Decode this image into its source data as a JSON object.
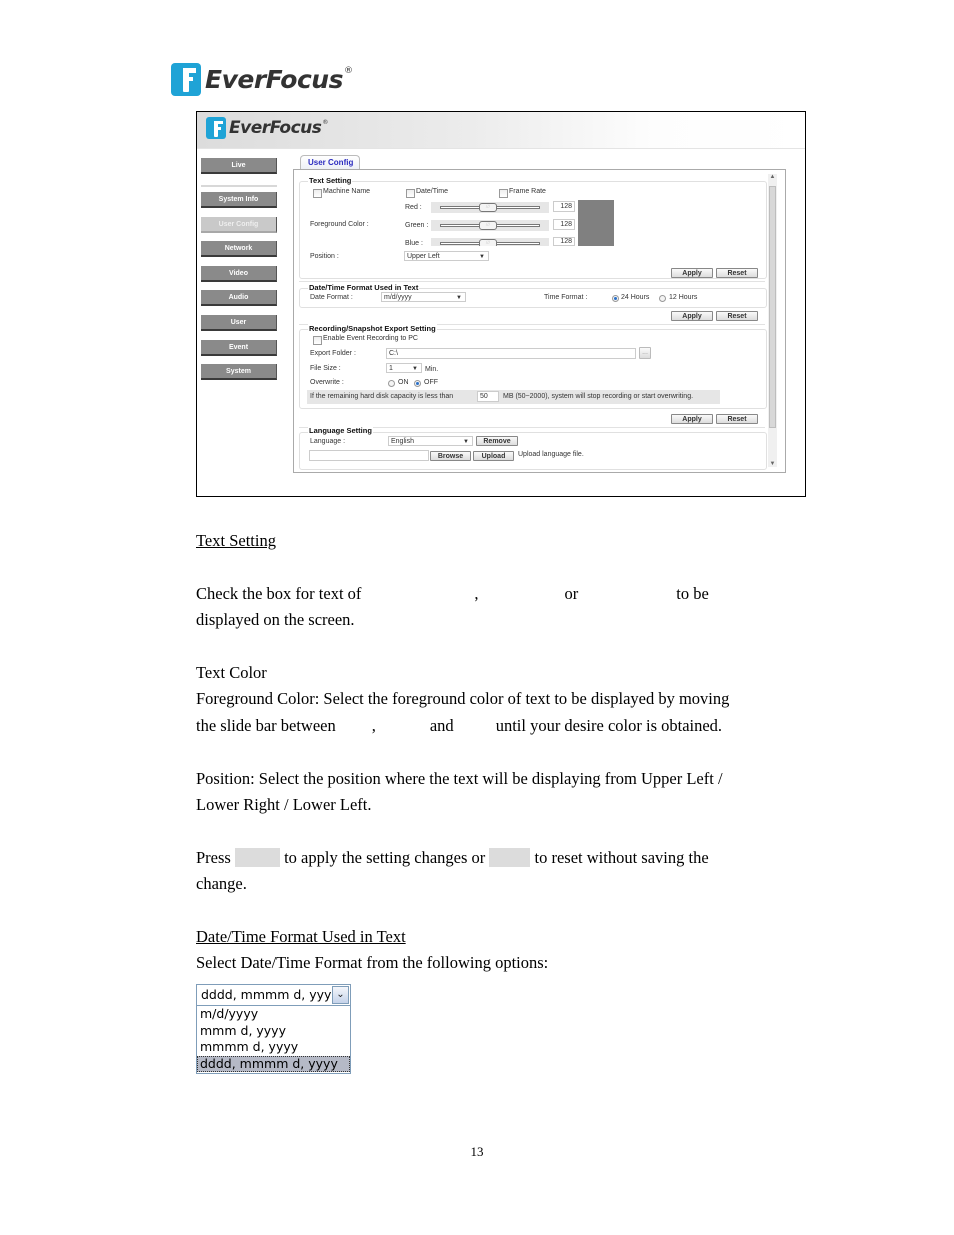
{
  "brand": {
    "name": "EverFocus",
    "reg": "®"
  },
  "screenshot": {
    "nav": [
      "Live",
      "System Info",
      "User Config",
      "Network",
      "Video",
      "Audio",
      "User",
      "Event",
      "System"
    ],
    "active_nav": "User Config",
    "tab": "User Config",
    "text_setting": {
      "title": "Text Setting",
      "checkboxes": [
        "Machine Name",
        "Date/Time",
        "Frame Rate"
      ],
      "foreground_label": "Foreground Color :",
      "red_label": "Red :",
      "green_label": "Green :",
      "blue_label": "Blue :",
      "red": "128",
      "green": "128",
      "blue": "128",
      "preview_color": "#808080",
      "position_label": "Position :",
      "position_value": "Upper Left"
    },
    "datetime": {
      "title": "Date/Time Format Used in Text",
      "date_label": "Date Format :",
      "date_value": "m/d/yyyy",
      "time_label": "Time Format :",
      "time_24": "24 Hours",
      "time_12": "12 Hours",
      "selected_time": "24 Hours"
    },
    "recording": {
      "title": "Recording/Snapshot Export Setting",
      "enable_label": "Enable Event Recording to PC",
      "export_label": "Export Folder :",
      "export_value": "C:\\",
      "browse_dots": "...",
      "filesize_label": "File Size :",
      "filesize_value": "1",
      "filesize_unit": "Min.",
      "overwrite_label": "Overwrite :",
      "on": "ON",
      "off": "OFF",
      "selected_overwrite": "OFF",
      "capacity_pre": "If the remaining hard disk capacity is less than",
      "capacity_value": "50",
      "capacity_post": "MB (50~2000), system will stop recording or start overwriting."
    },
    "language": {
      "title": "Language Setting",
      "label": "Language :",
      "value": "English",
      "remove": "Remove",
      "browse": "Browse",
      "upload": "Upload",
      "upload_hint": "Upload language file."
    },
    "apply": "Apply",
    "reset": "Reset"
  },
  "doc": {
    "h_text_setting": "Text Setting",
    "p1_a": "Check the box for text of",
    "p1_b": ",",
    "p1_c": "or",
    "p1_d": "to be",
    "p1_line2": "displayed on the screen.",
    "text_color": "Text Color",
    "fg_line1": "Foreground Color: Select the foreground color of text to be displayed by moving",
    "fg_a": "the slide bar between",
    "fg_b": ",",
    "fg_c": "and",
    "fg_d": "until your desire color is obtained.",
    "pos_line1": "Position: Select the position where the text will be displaying from Upper Left /",
    "pos_line2": "Lower Right / Lower Left.",
    "press": "Press",
    "press_mid": "to apply the setting changes or",
    "press_end": "to reset without saving the",
    "press_line2": "change.",
    "h_datetime": "Date/Time Format Used in Text",
    "select_line": "Select Date/Time Format from the following options:"
  },
  "date_select": {
    "value": "dddd, mmmm d, yyyy",
    "options": [
      "m/d/yyyy",
      "mmm d, yyyy",
      "mmmm d, yyyy",
      "dddd, mmmm d, yyyy"
    ],
    "highlighted": "dddd, mmmm d, yyyy"
  },
  "page_number": "13"
}
